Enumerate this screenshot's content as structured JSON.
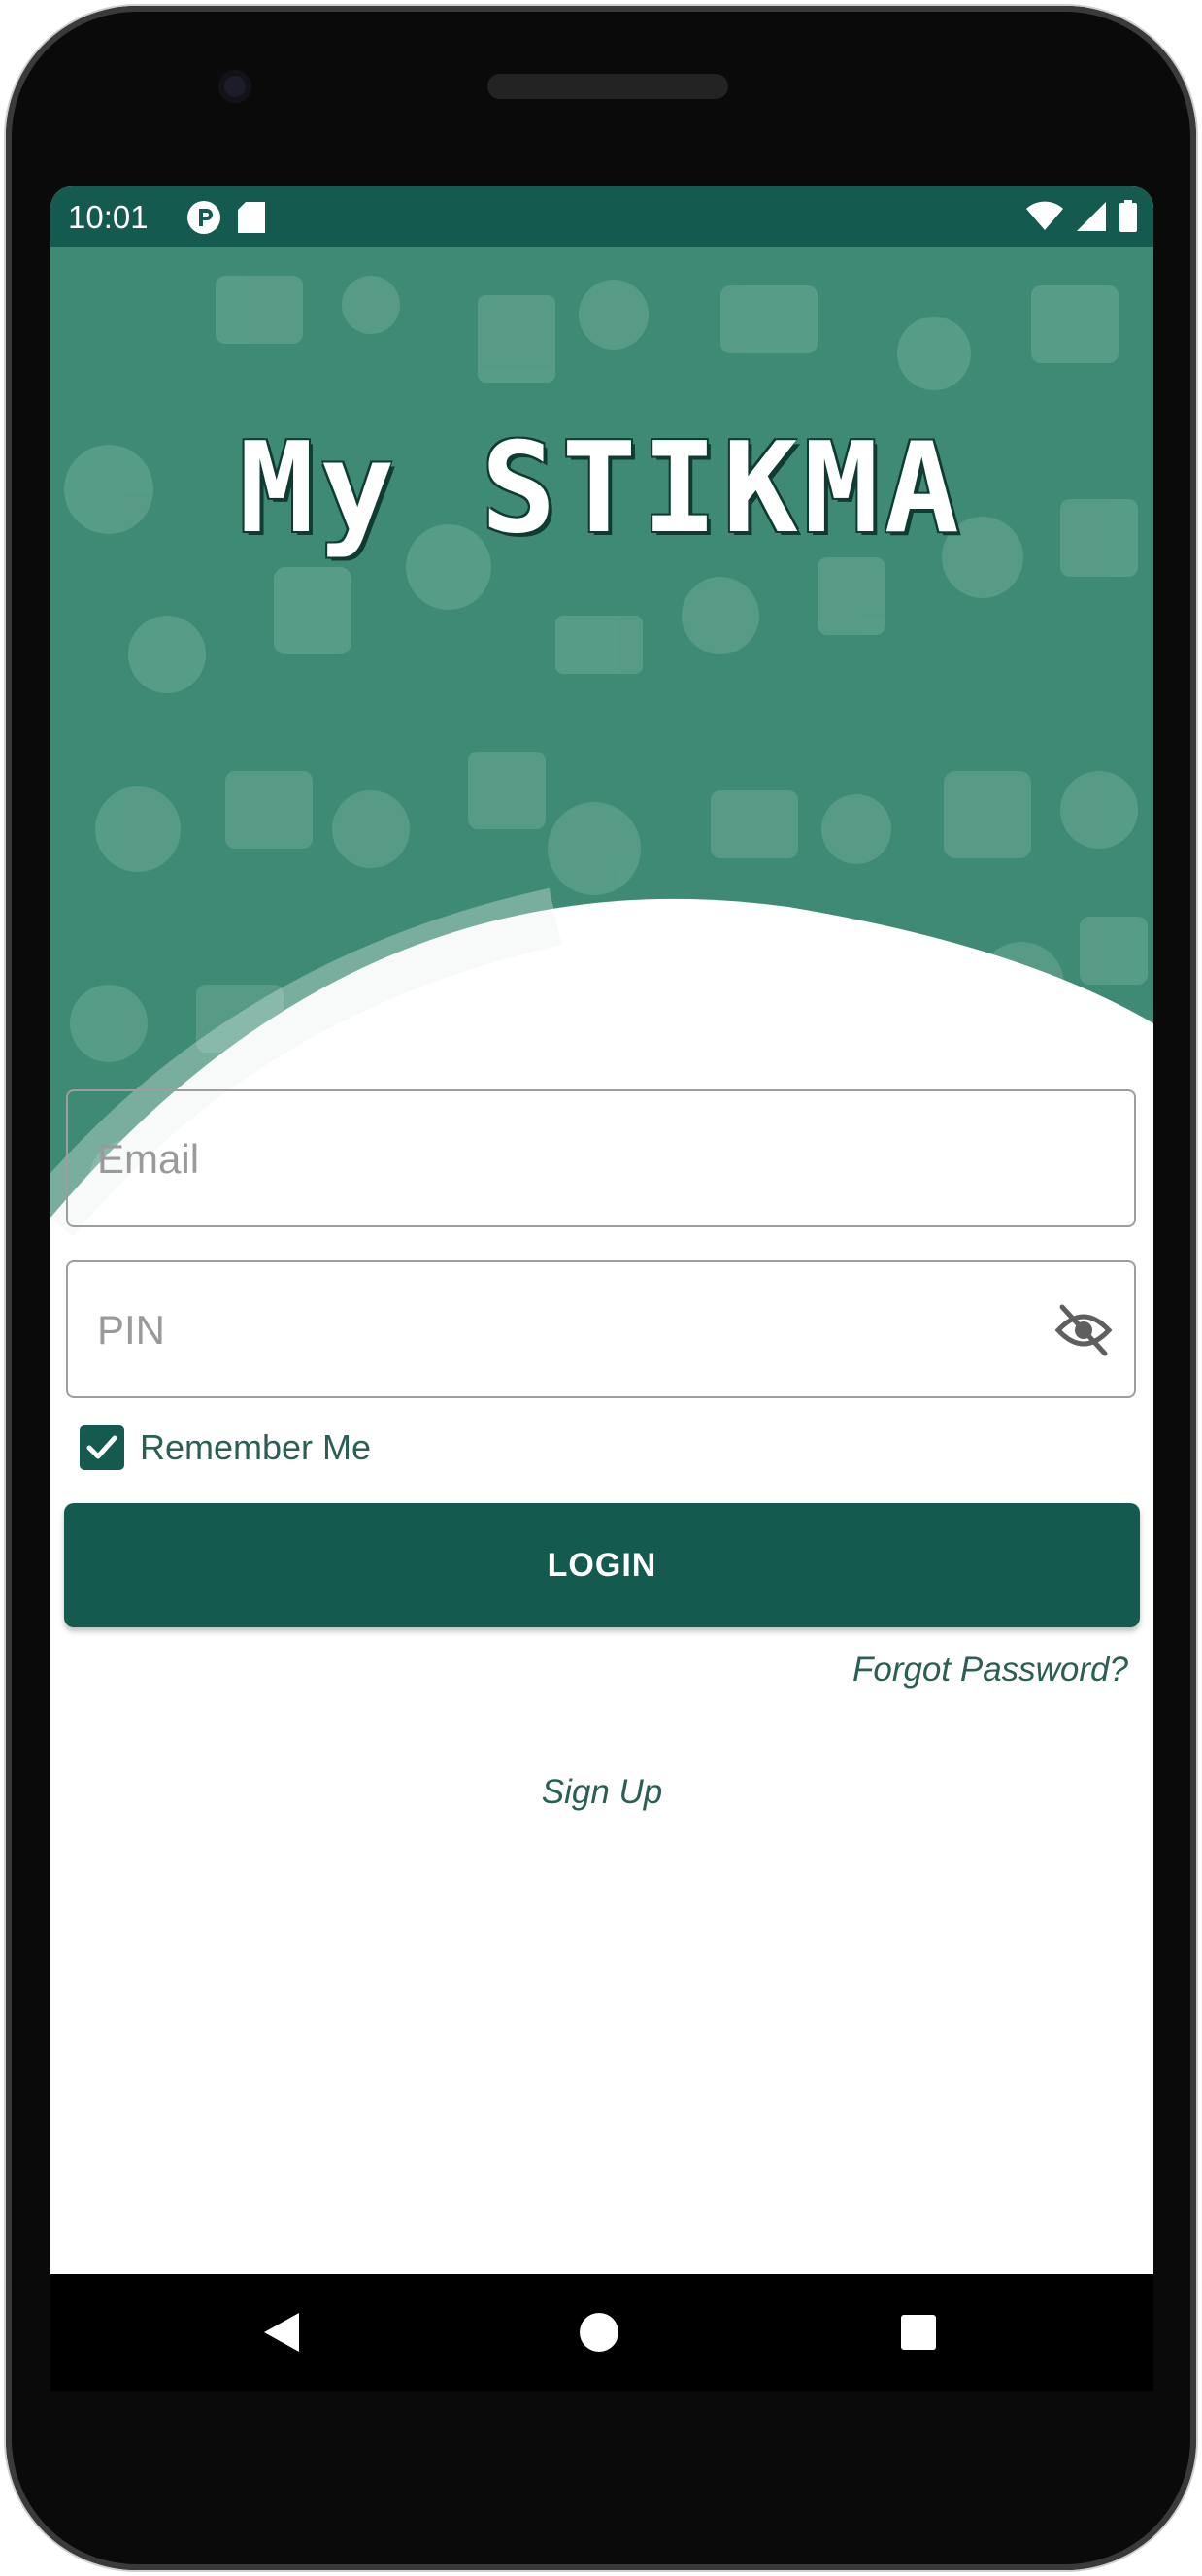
{
  "status_bar": {
    "time": "10:01",
    "left_icons": [
      "p-icon",
      "sd-card-icon"
    ],
    "right_icons": [
      "wifi-icon",
      "signal-icon",
      "battery-icon"
    ]
  },
  "header": {
    "title": "My STIKMA"
  },
  "form": {
    "email_placeholder": "Email",
    "email_value": "",
    "pin_placeholder": "PIN",
    "pin_value": "",
    "pin_toggle_icon": "eye-off-icon",
    "remember_label": "Remember Me",
    "remember_checked": true,
    "login_label": "LOGIN",
    "forgot_label": "Forgot Password?",
    "signup_label": "Sign Up"
  },
  "nav": {
    "icons": [
      "back-icon",
      "home-icon",
      "recents-icon"
    ]
  },
  "colors": {
    "primary": "#145a4f",
    "hero": "#3e8a74",
    "text_accent": "#2b5e54"
  }
}
